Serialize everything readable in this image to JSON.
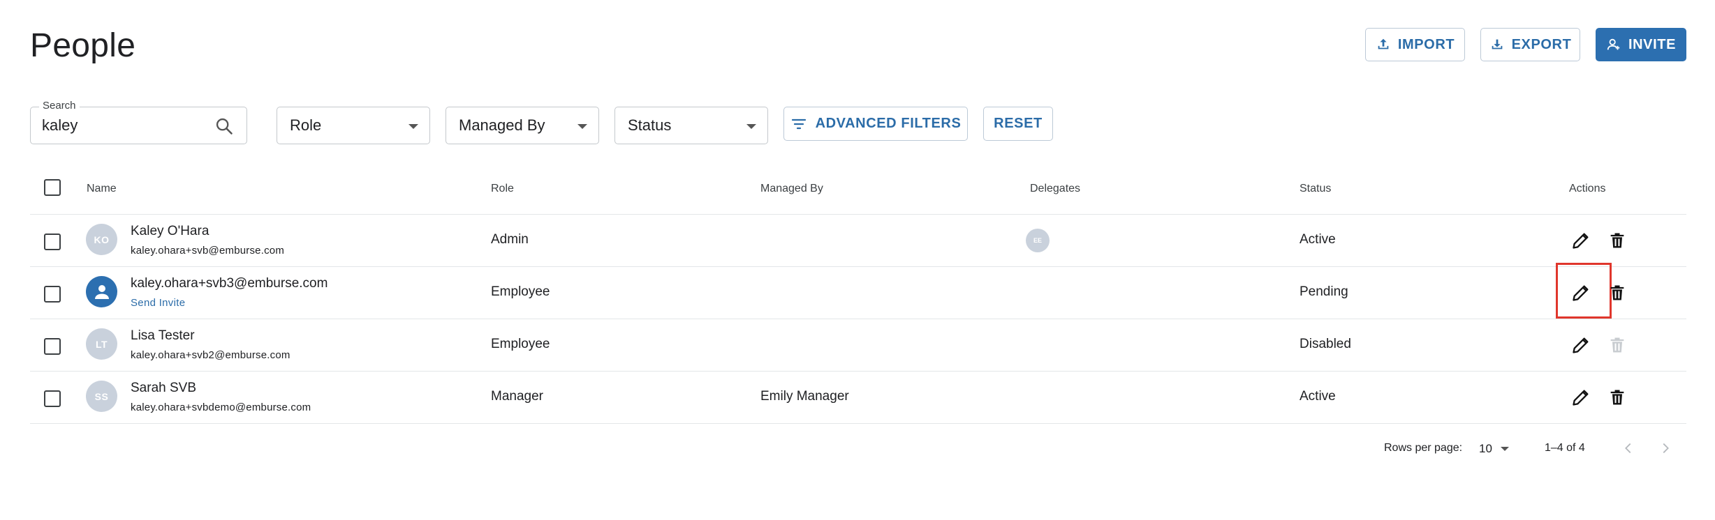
{
  "page": {
    "title": "People"
  },
  "toolbar": {
    "import_label": "IMPORT",
    "export_label": "EXPORT",
    "invite_label": "INVITE"
  },
  "search": {
    "label": "Search",
    "value": "kaley"
  },
  "filters": {
    "role_label": "Role",
    "managed_by_label": "Managed By",
    "status_label": "Status",
    "advanced_label": "ADVANCED FILTERS",
    "reset_label": "RESET"
  },
  "table": {
    "columns": {
      "name": "Name",
      "role": "Role",
      "managed_by": "Managed By",
      "delegates": "Delegates",
      "status": "Status",
      "actions": "Actions"
    },
    "rows": [
      {
        "initials": "KO",
        "name": "Kaley O'Hara",
        "email": "kaley.ohara+svb@emburse.com",
        "role": "Admin",
        "managed_by": "",
        "delegate": "EE",
        "status": "Active"
      },
      {
        "initials": "",
        "name": "kaley.ohara+svb3@emburse.com",
        "email": "",
        "send_invite": "Send Invite",
        "role": "Employee",
        "managed_by": "",
        "delegate": "",
        "status": "Pending"
      },
      {
        "initials": "LT",
        "name": "Lisa Tester",
        "email": "kaley.ohara+svb2@emburse.com",
        "role": "Employee",
        "managed_by": "",
        "delegate": "",
        "status": "Disabled"
      },
      {
        "initials": "SS",
        "name": "Sarah SVB",
        "email": "kaley.ohara+svbdemo@emburse.com",
        "role": "Manager",
        "managed_by": "Emily Manager",
        "delegate": "",
        "status": "Active"
      }
    ]
  },
  "pagination": {
    "rows_label": "Rows per page:",
    "rows_value": "10",
    "range": "1–4 of 4"
  },
  "colors": {
    "accent": "#2c6fb0",
    "highlight": "#e0362c",
    "avatar": "#c9d1dc"
  }
}
